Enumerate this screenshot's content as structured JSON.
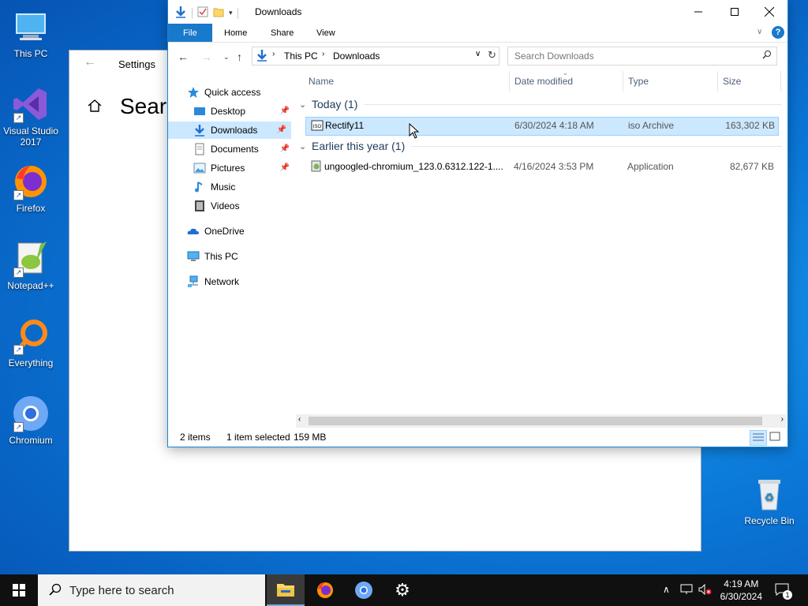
{
  "desktop": {
    "icons": [
      {
        "label": "This PC"
      },
      {
        "label": "Visual Studio\n2017"
      },
      {
        "label": "Firefox"
      },
      {
        "label": "Notepad++"
      },
      {
        "label": "Everything"
      },
      {
        "label": "Chromium"
      },
      {
        "label": "Recycle Bin"
      }
    ]
  },
  "settings": {
    "title": "Settings",
    "heading": "Searc"
  },
  "explorer": {
    "window_title": "Downloads",
    "ribbon_tabs": [
      "File",
      "Home",
      "Share",
      "View"
    ],
    "address": {
      "crumbs": [
        "This PC",
        "Downloads"
      ]
    },
    "search_placeholder": "Search Downloads",
    "nav": {
      "quick_access": "Quick access",
      "items": [
        "Desktop",
        "Downloads",
        "Documents",
        "Pictures",
        "Music",
        "Videos"
      ],
      "onedrive": "OneDrive",
      "this_pc": "This PC",
      "network": "Network"
    },
    "columns": [
      "Name",
      "Date modified",
      "Type",
      "Size"
    ],
    "groups": [
      {
        "label": "Today (1)",
        "files": [
          {
            "name": "Rectify11",
            "date": "6/30/2024 4:18 AM",
            "type": "iso Archive",
            "size": "163,302 KB"
          }
        ]
      },
      {
        "label": "Earlier this year (1)",
        "files": [
          {
            "name": "ungoogled-chromium_123.0.6312.122-1....",
            "date": "4/16/2024 3:53 PM",
            "type": "Application",
            "size": "82,677 KB"
          }
        ]
      }
    ],
    "status": {
      "count": "2 items",
      "selected": "1 item selected",
      "size": "159 MB"
    }
  },
  "taskbar": {
    "search_placeholder": "Type here to search",
    "time": "4:19 AM",
    "date": "6/30/2024",
    "notification_count": "1"
  },
  "colors": {
    "accent": "#1979ca",
    "selection": "#cce8ff",
    "taskbar": "#101010"
  }
}
